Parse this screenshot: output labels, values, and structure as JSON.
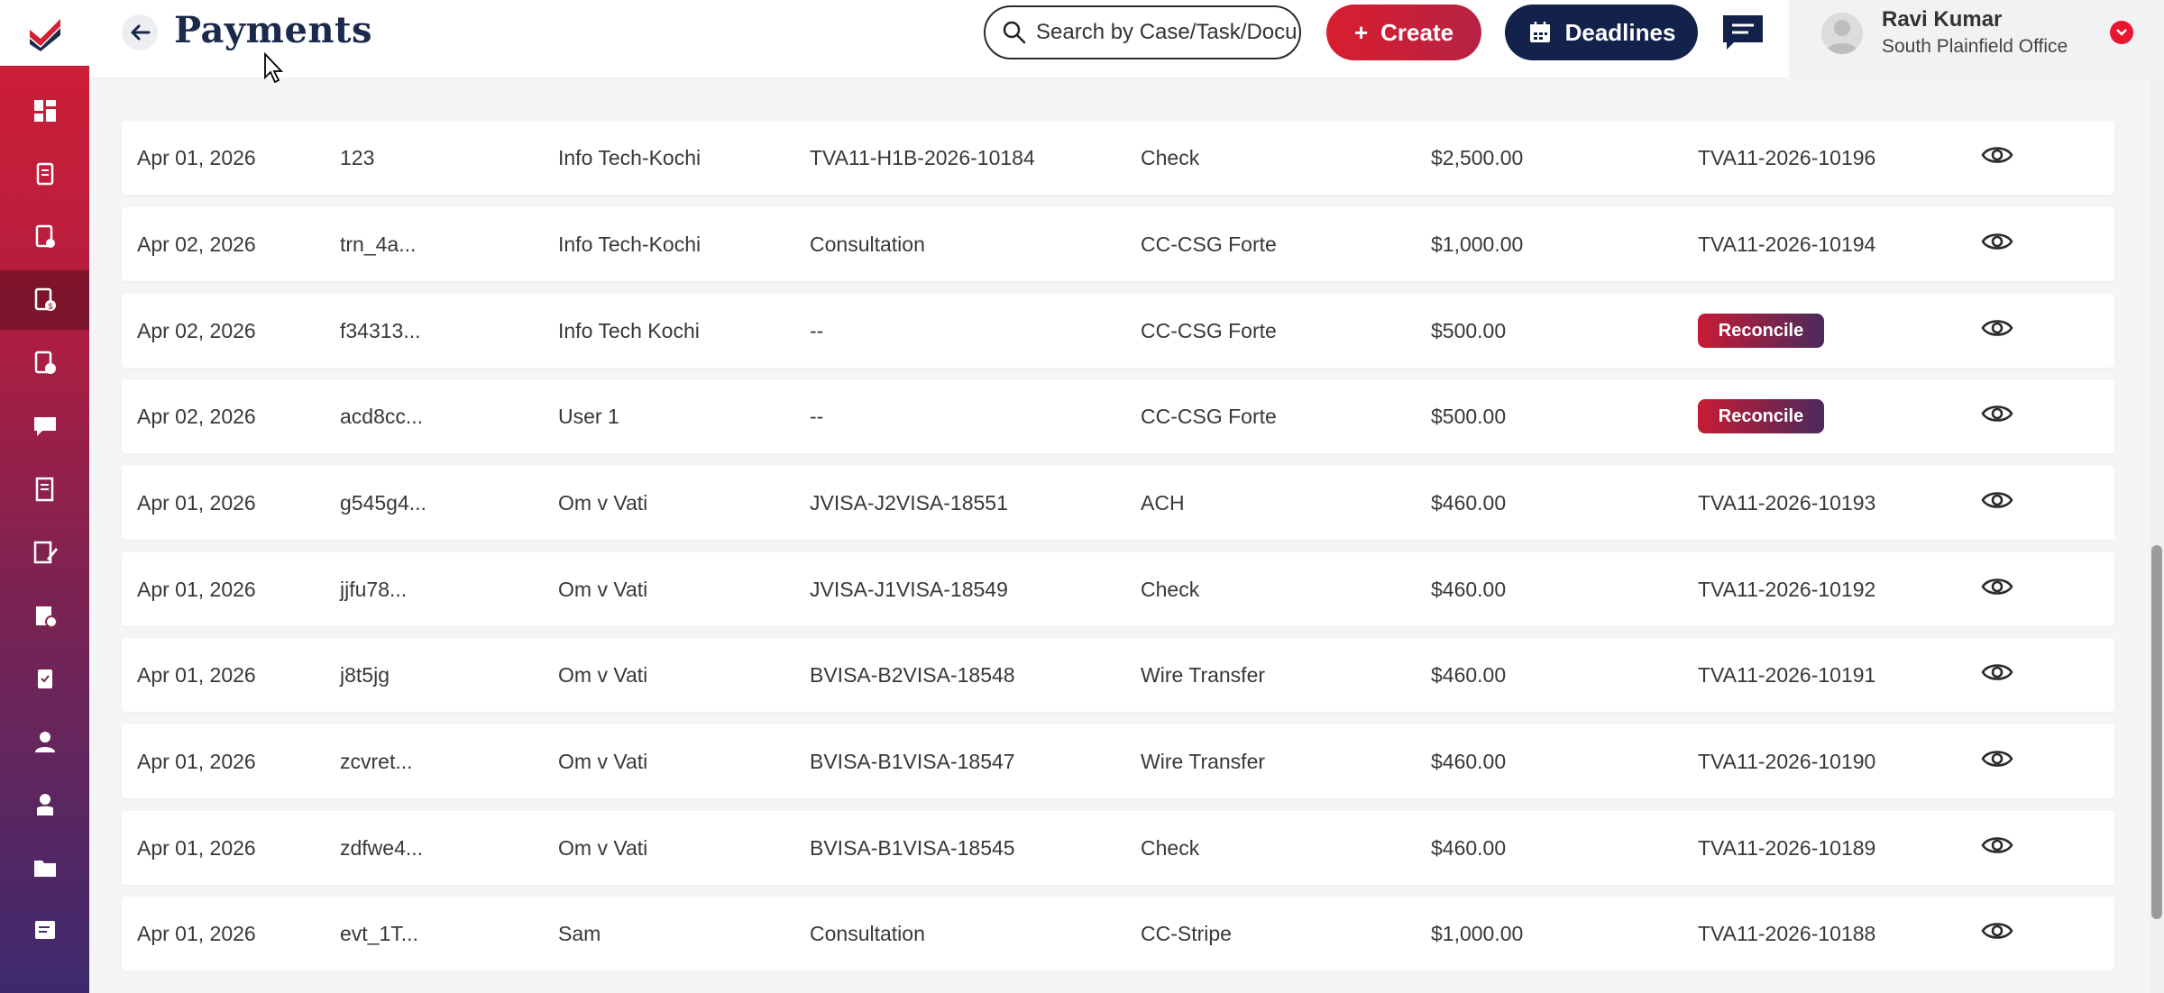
{
  "header": {
    "title": "Payments",
    "search_placeholder": "Search by Case/Task/Docu",
    "create_label": "Create",
    "deadlines_label": "Deadlines"
  },
  "user": {
    "name": "Ravi Kumar",
    "office": "South Plainfield Office"
  },
  "sidebar": {
    "items": [
      {
        "icon": "dashboard-icon"
      },
      {
        "icon": "documents-icon"
      },
      {
        "icon": "forms-icon"
      },
      {
        "icon": "payments-icon",
        "active": true
      },
      {
        "icon": "invoice-check-icon"
      },
      {
        "icon": "messages-icon"
      },
      {
        "icon": "ledger-icon"
      },
      {
        "icon": "notes-edit-icon"
      },
      {
        "icon": "reports-icon"
      },
      {
        "icon": "tasks-icon"
      },
      {
        "icon": "contacts-icon"
      },
      {
        "icon": "users-icon"
      },
      {
        "icon": "folder-icon"
      },
      {
        "icon": "notes-icon"
      }
    ]
  },
  "table": {
    "rows": [
      {
        "date": "Apr 01, 2026",
        "txn": "123",
        "client": "Info Tech-Kochi",
        "case": "TVA11-H1B-2026-10184",
        "method": "Check",
        "amount": "$2,500.00",
        "invoice": "TVA11-2026-10196"
      },
      {
        "date": "Apr 02, 2026",
        "txn": "trn_4a...",
        "client": "Info Tech-Kochi",
        "case": "Consultation",
        "method": "CC-CSG Forte",
        "amount": "$1,000.00",
        "invoice": "TVA11-2026-10194"
      },
      {
        "date": "Apr 02, 2026",
        "txn": "f34313...",
        "client": "Info Tech Kochi",
        "case": "--",
        "method": "CC-CSG Forte",
        "amount": "$500.00",
        "invoice": "",
        "action": "Reconcile"
      },
      {
        "date": "Apr 02, 2026",
        "txn": "acd8cc...",
        "client": "User 1",
        "case": "--",
        "method": "CC-CSG Forte",
        "amount": "$500.00",
        "invoice": "",
        "action": "Reconcile"
      },
      {
        "date": "Apr 01, 2026",
        "txn": "g545g4...",
        "client": "Om v Vati",
        "case": "JVISA-J2VISA-18551",
        "method": "ACH",
        "amount": "$460.00",
        "invoice": "TVA11-2026-10193"
      },
      {
        "date": "Apr 01, 2026",
        "txn": "jjfu78...",
        "client": "Om v Vati",
        "case": "JVISA-J1VISA-18549",
        "method": "Check",
        "amount": "$460.00",
        "invoice": "TVA11-2026-10192"
      },
      {
        "date": "Apr 01, 2026",
        "txn": "j8t5jg",
        "client": "Om v Vati",
        "case": "BVISA-B2VISA-18548",
        "method": "Wire Transfer",
        "amount": "$460.00",
        "invoice": "TVA11-2026-10191"
      },
      {
        "date": "Apr 01, 2026",
        "txn": "zcvret...",
        "client": "Om v Vati",
        "case": "BVISA-B1VISA-18547",
        "method": "Wire Transfer",
        "amount": "$460.00",
        "invoice": "TVA11-2026-10190"
      },
      {
        "date": "Apr 01, 2026",
        "txn": "zdfwe4...",
        "client": "Om v Vati",
        "case": "BVISA-B1VISA-18545",
        "method": "Check",
        "amount": "$460.00",
        "invoice": "TVA11-2026-10189"
      },
      {
        "date": "Apr 01, 2026",
        "txn": "evt_1T...",
        "client": "Sam",
        "case": "Consultation",
        "method": "CC-Stripe",
        "amount": "$1,000.00",
        "invoice": "TVA11-2026-10188"
      }
    ]
  },
  "colors": {
    "brand_red": "#d41f35",
    "navy": "#13224a",
    "title": "#1b2a4a"
  }
}
